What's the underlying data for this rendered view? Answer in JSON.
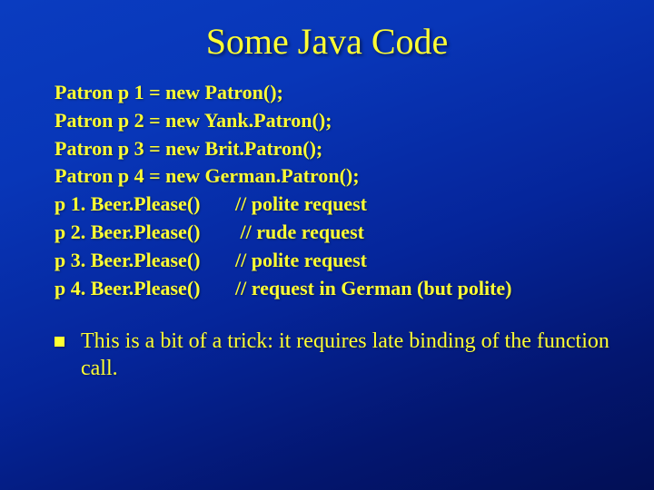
{
  "title": "Some Java Code",
  "code": {
    "l1": "Patron p 1 = new Patron();",
    "l2": "Patron p 2 = new Yank.Patron();",
    "l3": "Patron p 3 = new Brit.Patron();",
    "l4": "Patron p 4 = new German.Patron();",
    "l5": "p 1. Beer.Please()       // polite request",
    "l6": "p 2. Beer.Please()        // rude request",
    "l7": "p 3. Beer.Please()       // polite request",
    "l8": "p 4. Beer.Please()       // request in German (but polite)"
  },
  "bullet": "This is a bit of a trick: it requires late binding of the function call."
}
